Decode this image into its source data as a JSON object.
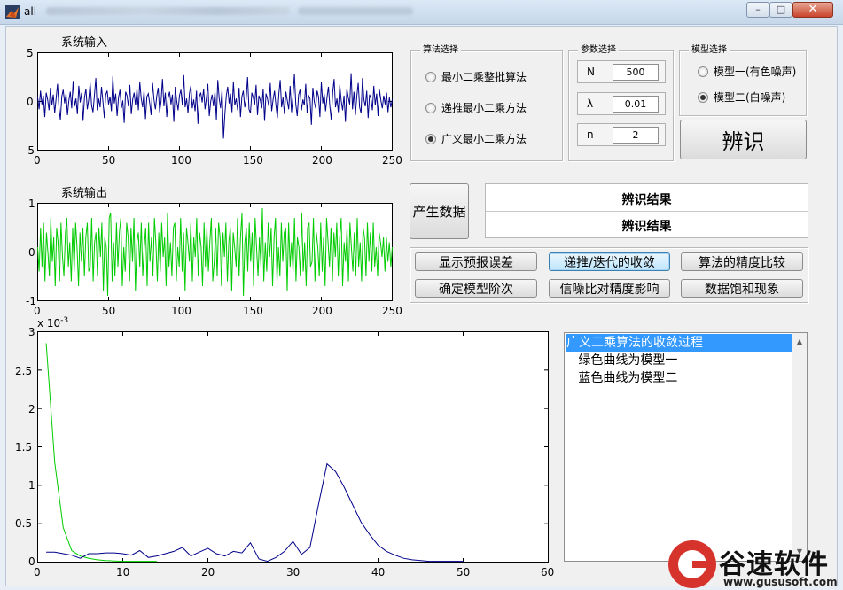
{
  "window": {
    "title": "all",
    "min_glyph": "–",
    "max_glyph": "□",
    "close_glyph": "✕"
  },
  "input_axes": {
    "title": "系统输入",
    "y_ticks": [
      "5",
      "0",
      "-5"
    ],
    "x_ticks": [
      "0",
      "50",
      "100",
      "150",
      "200",
      "250"
    ]
  },
  "output_axes": {
    "title": "系统输出",
    "y_ticks": [
      "1",
      "0",
      "-1"
    ],
    "x_ticks": [
      "0",
      "50",
      "100",
      "150",
      "200",
      "250"
    ]
  },
  "conv_axes": {
    "exponent": "x 10",
    "exponent_power": "-3",
    "y_ticks": [
      "3",
      "2.5",
      "2",
      "1.5",
      "1",
      "0.5",
      "0"
    ],
    "x_ticks": [
      "0",
      "10",
      "20",
      "30",
      "40",
      "50",
      "60"
    ]
  },
  "algorithm_panel": {
    "title": "算法选择",
    "options": [
      "最小二乘整批算法",
      "递推最小二乘方法",
      "广义最小二乘方法"
    ],
    "selected_index": 2
  },
  "param_panel": {
    "title": "参数选择",
    "params": [
      {
        "label": "N",
        "value": "500"
      },
      {
        "label": "λ",
        "value": "0.01"
      },
      {
        "label": "n",
        "value": "2"
      }
    ]
  },
  "model_panel": {
    "title": "模型选择",
    "options": [
      "模型一(有色噪声)",
      "模型二(白噪声)"
    ],
    "selected_index": 1
  },
  "buttons": {
    "identify": "辨识",
    "generate": "产生数据",
    "show_error": "显示预报误差",
    "convergence": "递推/迭代的收敛",
    "precision_compare": "算法的精度比较",
    "model_order": "确定模型阶次",
    "snr_effect": "信噪比对精度影响",
    "saturation": "数据饱和现象"
  },
  "results": {
    "line1": "辨识结果",
    "line2": "辨识结果"
  },
  "listbox": {
    "items": [
      "广义二乘算法的收敛过程",
      "   绿色曲线为模型一",
      "   蓝色曲线为模型二"
    ],
    "selected_index": 0,
    "up_arrow": "▲",
    "down_arrow": "▼"
  },
  "colors": {
    "series_blue": "#00008b",
    "series_green": "#00cc00",
    "selection": "#3399ff"
  },
  "watermark": {
    "name": "谷速软件",
    "url": "www.gususoft.com"
  },
  "chart_data": [
    {
      "type": "line",
      "title": "系统输入",
      "xlim": [
        0,
        250
      ],
      "ylim": [
        -5,
        5
      ],
      "series": [
        {
          "color": "#00008b",
          "description": "random input sequence, 250 samples, amplitude about ±3",
          "x_range": [
            0,
            250
          ],
          "y": [
            0.4,
            -0.8,
            1.1,
            -0.3,
            0.6,
            -1.6,
            0.9,
            0.2,
            -0.9,
            1.4,
            -0.4,
            0.7,
            -1.2,
            0.3,
            1.8,
            -0.6,
            -1.9,
            0.5,
            1.2,
            -0.2,
            0.8,
            -1.4,
            0.1,
            1.0,
            -0.7,
            2.1,
            -0.5,
            0.3,
            -1.3,
            1.6,
            -0.1,
            0.9,
            -2.0,
            0.4,
            1.3,
            -0.8,
            0.2,
            1.9,
            -0.4,
            -1.1,
            0.6,
            2.4,
            -0.9,
            0.3,
            -0.6,
            1.5,
            0.0,
            -1.7,
            0.7,
            1.1,
            -0.3,
            0.5,
            -1.0,
            2.6,
            -0.2,
            0.8,
            -1.5,
            0.4,
            1.2,
            -0.7,
            0.1,
            -2.2,
            1.0,
            0.6,
            -0.5,
            1.7,
            -1.3,
            0.2,
            0.9,
            -0.4,
            1.3,
            -0.9,
            2.0,
            0.3,
            -0.6,
            1.1,
            -1.8,
            0.5,
            0.8,
            -0.2,
            -1.4,
            1.9,
            0.2,
            -0.8,
            0.6,
            1.4,
            -1.1,
            0.0,
            2.3,
            -0.5,
            0.9,
            -1.6,
            0.4,
            1.0,
            -0.3,
            0.7,
            -2.1,
            1.5,
            0.1,
            -0.9,
            0.6,
            1.2,
            -0.4,
            2.7,
            -0.6,
            0.3,
            -1.2,
            0.8,
            1.6,
            -0.7,
            0.2,
            -1.0,
            1.1,
            -2.3,
            0.5,
            0.9,
            -0.1,
            1.3,
            -0.8,
            0.4,
            1.8,
            -1.5,
            0.0,
            0.7,
            -0.5,
            1.0,
            -1.9,
            2.2,
            0.3,
            -0.7,
            1.2,
            -3.8,
            -1.3,
            0.6,
            1.5,
            -0.2,
            0.8,
            -1.1,
            2.0,
            -0.4,
            0.3,
            -0.9,
            1.4,
            -1.6,
            0.5,
            1.1,
            -0.6,
            0.2,
            2.5,
            -0.8,
            -1.2,
            0.9,
            0.4,
            -0.3,
            1.7,
            -1.4,
            0.6,
            0.1,
            -0.7,
            1.3,
            -2.0,
            0.8,
            0.3,
            -0.5,
            1.9,
            -1.0,
            0.2,
            1.1,
            -0.4,
            -1.7,
            0.7,
            2.2,
            -0.6,
            0.4,
            -1.3,
            1.0,
            0.1,
            -0.8,
            1.6,
            -1.1,
            0.5,
            2.8,
            -0.3,
            -1.5,
            0.7,
            1.2,
            -0.9,
            0.2,
            -0.4,
            1.8,
            -1.2,
            0.6,
            0.3,
            -2.4,
            1.4,
            0.0,
            -0.7,
            1.1,
            0.5,
            -1.6,
            2.0,
            -0.2,
            0.8,
            -1.0,
            0.4,
            1.5,
            -0.5,
            -1.9,
            0.9,
            2.3,
            -0.6,
            0.3,
            -1.1,
            1.7,
            0.1,
            -0.9,
            0.6,
            -2.1,
            1.3,
            0.4,
            -0.3,
            2.9,
            -0.8,
            1.0,
            -1.4,
            0.5,
            1.9,
            -0.6,
            -1.2,
            2.4,
            0.2,
            -0.5,
            1.1,
            -1.7,
            0.7,
            0.3,
            -0.9,
            1.6,
            -0.4,
            0.8,
            -1.5,
            1.2,
            0.1,
            -0.7,
            0.6,
            -0.3,
            0.9,
            -1.1,
            0.4,
            -0.6,
            0.2
          ]
        }
      ]
    },
    {
      "type": "line",
      "title": "系统输出",
      "xlim": [
        0,
        250
      ],
      "ylim": [
        -1,
        1
      ],
      "series": [
        {
          "color": "#00cc00",
          "description": "oscillating output, about ±0.8",
          "x_range": [
            0,
            250
          ],
          "y": [
            0.1,
            -0.4,
            0.5,
            -0.3,
            0.6,
            -0.6,
            0.4,
            0.0,
            -0.5,
            0.7,
            -0.2,
            0.3,
            -0.7,
            0.5,
            0.2,
            -0.6,
            0.6,
            -0.1,
            -0.5,
            0.4,
            0.7,
            -0.3,
            0.2,
            -0.6,
            0.5,
            -0.4,
            0.6,
            0.1,
            -0.7,
            0.4,
            -0.2,
            0.5,
            -0.5,
            0.3,
            0.6,
            -0.4,
            -0.3,
            0.7,
            -0.6,
            0.2,
            0.4,
            -0.5,
            0.5,
            -0.1,
            0.6,
            -0.8,
            0.3,
            0.1,
            -0.9,
            0.7,
            0.8,
            -0.6,
            0.2,
            -0.5,
            0.6,
            -0.3,
            0.4,
            0.7,
            -0.7,
            0.1,
            -0.4,
            0.6,
            0.3,
            -0.6,
            0.5,
            -0.2,
            0.7,
            -0.8,
            0.2,
            0.4,
            -0.3,
            0.6,
            -0.5,
            0.1,
            0.5,
            -0.7,
            0.6,
            -0.2,
            0.3,
            -0.5,
            0.7,
            0.2,
            -0.6,
            0.4,
            -0.4,
            0.6,
            -0.1,
            0.3,
            -0.7,
            0.8,
            -0.3,
            0.2,
            -0.5,
            0.5,
            0.6,
            -0.6,
            0.1,
            -0.3,
            0.7,
            -0.4,
            0.4,
            -0.8,
            0.5,
            0.2,
            -0.2,
            0.6,
            -0.6,
            0.3,
            -0.1,
            0.7,
            -0.5,
            0.4,
            0.1,
            -0.7,
            0.6,
            -0.3,
            0.5,
            -0.4,
            0.2,
            0.7,
            -0.6,
            -0.2,
            0.5,
            -0.5,
            0.6,
            0.3,
            -0.7,
            0.4,
            -0.1,
            0.6,
            -0.6,
            0.2,
            0.5,
            -0.8,
            0.4,
            0.1,
            -0.3,
            0.7,
            -0.5,
            0.3,
            0.8,
            -0.9,
            0.2,
            0.5,
            -0.4,
            0.6,
            -0.2,
            0.4,
            -0.7,
            0.7,
            0.1,
            -0.5,
            0.3,
            -0.3,
            0.9,
            -0.6,
            0.2,
            -0.4,
            0.6,
            -0.1,
            0.5,
            -0.7,
            0.3,
            0.7,
            -0.6,
            0.1,
            -0.5,
            0.6,
            -0.2,
            0.4,
            0.5,
            -0.8,
            0.6,
            -0.3,
            0.2,
            -0.4,
            0.7,
            -0.6,
            0.3,
            0.1,
            -0.5,
            0.8,
            -0.4,
            0.2,
            -0.7,
            0.5,
            0.6,
            -0.3,
            -0.2,
            0.7,
            -0.6,
            0.4,
            0.1,
            -0.5,
            0.6,
            -0.4,
            0.3,
            -0.7,
            0.7,
            0.2,
            -0.3,
            0.5,
            -0.6,
            0.4,
            -0.1,
            0.6,
            -0.5,
            0.3,
            0.7,
            -0.7,
            0.2,
            -0.2,
            0.5,
            -0.6,
            0.6,
            0.1,
            -0.4,
            0.4,
            -0.5,
            0.7,
            -0.3,
            0.2,
            -0.6,
            0.5,
            0.3,
            -0.5,
            0.6,
            -0.2,
            0.4,
            -0.4,
            0.6,
            -0.3,
            0.1,
            -0.5,
            0.4,
            0.2,
            -0.1,
            0.3,
            -0.4,
            0.3,
            -0.2,
            0.2,
            -0.3,
            0.1
          ]
        }
      ]
    },
    {
      "type": "line",
      "xlim": [
        0,
        60
      ],
      "ylim": [
        0,
        0.003
      ],
      "y_exponent": -3,
      "series": [
        {
          "color": "#00cc00",
          "x": [
            1,
            2,
            3,
            4,
            5,
            6,
            7,
            8,
            9,
            10,
            11,
            12,
            13,
            14
          ],
          "y": [
            0.00285,
            0.0013,
            0.00045,
            0.00015,
            8e-05,
            5e-05,
            3e-05,
            2e-05,
            1.5e-05,
            1e-05,
            1e-05,
            1e-05,
            1e-05,
            1e-05
          ]
        },
        {
          "color": "#00008b",
          "x": [
            1,
            2,
            3,
            4,
            5,
            6,
            7,
            8,
            9,
            10,
            11,
            12,
            13,
            14,
            15,
            16,
            17,
            18,
            19,
            20,
            21,
            22,
            23,
            24,
            25,
            26,
            27,
            28,
            29,
            30,
            31,
            32,
            33,
            34,
            35,
            36,
            37,
            38,
            39,
            40,
            41,
            42,
            43,
            44,
            45,
            46,
            47,
            48,
            49,
            50
          ],
          "y": [
            0.00013,
            0.00013,
            0.00011,
            9e-05,
            5e-05,
            0.00011,
            0.00011,
            0.00012,
            0.00012,
            0.00011,
            9e-05,
            0.00015,
            6e-05,
            8e-05,
            0.00011,
            0.00014,
            0.00019,
            8e-05,
            0.00013,
            0.00018,
            0.00011,
            8e-05,
            0.00014,
            0.00012,
            0.00025,
            4e-05,
            1e-05,
            6e-05,
            0.00014,
            0.00027,
            0.0001,
            0.00019,
            0.00075,
            0.00128,
            0.00118,
            0.00098,
            0.00075,
            0.00052,
            0.00036,
            0.00022,
            0.00014,
            9e-05,
            5e-05,
            3e-05,
            2e-05,
            1e-05,
            1e-05,
            1e-05,
            1e-05,
            1e-05
          ]
        }
      ]
    }
  ]
}
